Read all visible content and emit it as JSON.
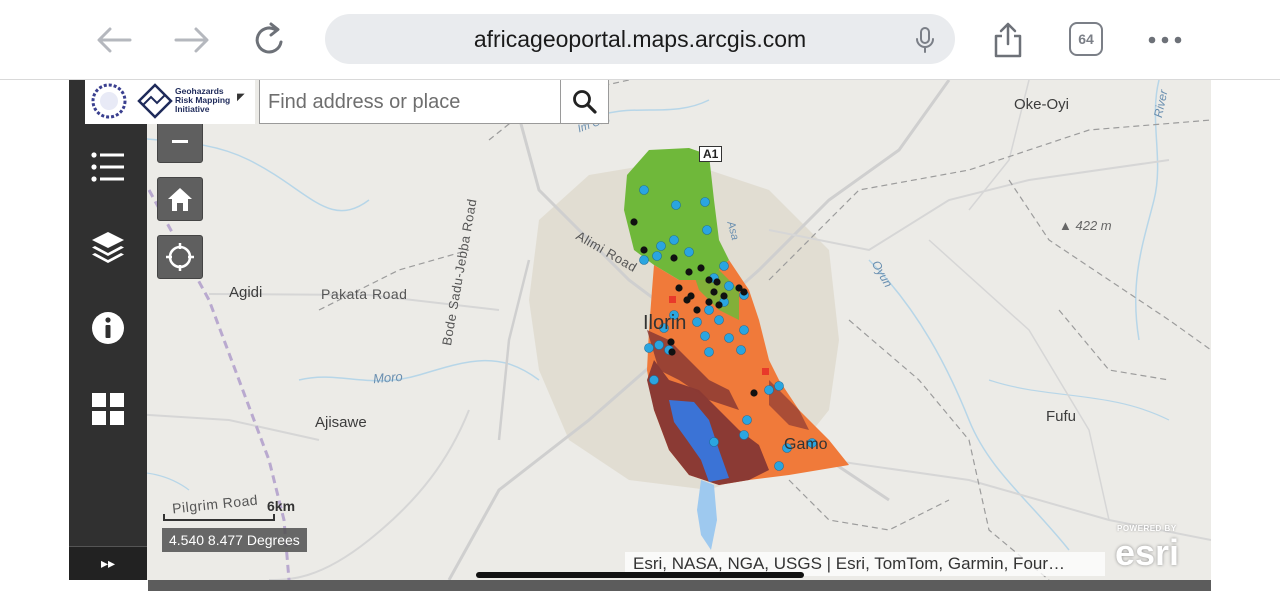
{
  "browser": {
    "url": "africageoportal.maps.arcgis.com",
    "tab_count": "64",
    "icons": [
      "back-arrow-icon",
      "forward-arrow-icon",
      "reload-icon",
      "microphone-icon",
      "share-icon",
      "tabs-icon",
      "more-icon"
    ]
  },
  "app": {
    "logo_text_line1": "Geohazards",
    "logo_text_line2": "Risk Mapping",
    "logo_text_line3": "Initiative",
    "search_placeholder": "Find address or place",
    "sidebar_icons": [
      "legend-list-icon",
      "layers-icon",
      "info-icon",
      "widgets-grid-icon"
    ],
    "expand_label": "▸▸"
  },
  "map": {
    "place_labels": {
      "oke_oyi": "Oke-Oyi",
      "agidi": "Agidi",
      "pakata_road": "Pakata Road",
      "ajisawe": "Ajisawe",
      "fufu": "Fufu",
      "moro": "Moro",
      "bode_road": "Bode Sadu-Jebba Road",
      "alimi_road": "Alimi Road",
      "ilorin": "Ilorin",
      "gamo": "Gamo",
      "pilgrim_road": "Pilgrim Road",
      "river": "River",
      "oyun": "Oyun",
      "asa": "Asa",
      "elevation": "422 m",
      "highway": "A1",
      "asa_label": "Asa",
      "im_label": "Im Oru"
    },
    "scale_label": "6km",
    "coordinates": "4.540 8.477 Degrees",
    "attribution": "Esri, NASA, NGA, USGS | Esri, TomTom, Garmin, Four…",
    "esri_powered": "POWERED BY",
    "esri_name": "esri"
  },
  "colors": {
    "green_zone": "#6fb83a",
    "orange_zone": "#f07a3a",
    "brown_zone": "#8b3a34",
    "water": "#3b73d6",
    "marker_blue": "#2aa5e0",
    "marker_black": "#111111",
    "sidebar": "#303030"
  }
}
